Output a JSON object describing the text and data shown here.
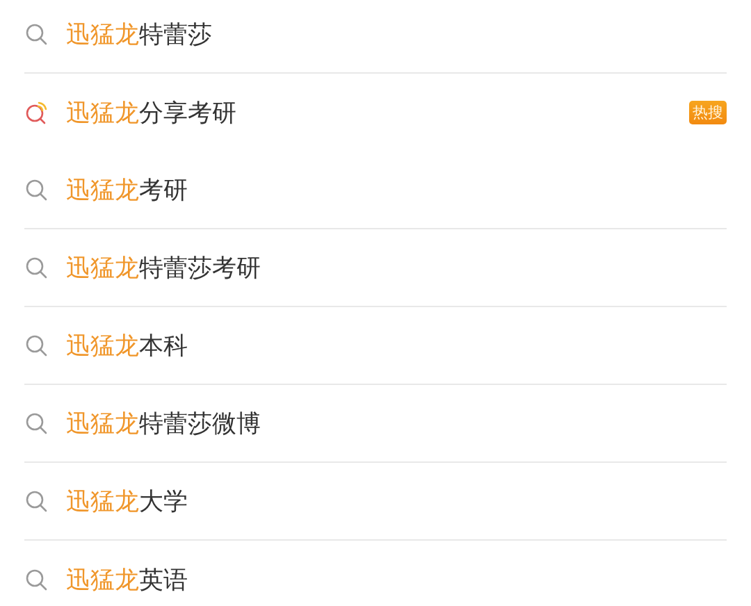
{
  "suggestions": [
    {
      "kind": "normal",
      "highlight": "迅猛龙",
      "rest": "特蕾莎"
    },
    {
      "kind": "hot",
      "highlight": "迅猛龙",
      "rest": "分享考研",
      "badge": "热搜"
    },
    {
      "kind": "normal",
      "highlight": "迅猛龙",
      "rest": "考研"
    },
    {
      "kind": "normal",
      "highlight": "迅猛龙",
      "rest": "特蕾莎考研"
    },
    {
      "kind": "normal",
      "highlight": "迅猛龙",
      "rest": "本科"
    },
    {
      "kind": "normal",
      "highlight": "迅猛龙",
      "rest": "特蕾莎微博"
    },
    {
      "kind": "normal",
      "highlight": "迅猛龙",
      "rest": "大学"
    },
    {
      "kind": "normal",
      "highlight": "迅猛龙",
      "rest": "英语"
    }
  ]
}
